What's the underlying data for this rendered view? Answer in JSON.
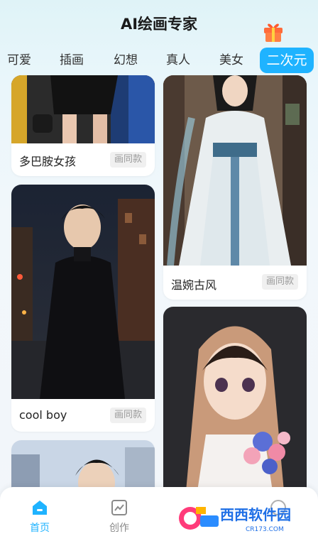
{
  "header": {
    "title": "AI绘画专家"
  },
  "tabs": [
    "可爱",
    "插画",
    "幻想",
    "真人",
    "美女",
    "二次元"
  ],
  "active_tab": "二次元",
  "cards": [
    {
      "caption": "多巴胺女孩",
      "same_label": "画同款"
    },
    {
      "caption": "温婉古风",
      "same_label": "画同款"
    },
    {
      "caption": "cool boy",
      "same_label": "画同款"
    }
  ],
  "nav": {
    "home": "首页",
    "create": "创作"
  },
  "watermark": {
    "brand": "西西软件园",
    "site": "CR173.COM"
  },
  "colors": {
    "accent": "#1fb3ff",
    "nav_active": "#1fb3ff",
    "nav_inactive": "#8a8a8a"
  }
}
